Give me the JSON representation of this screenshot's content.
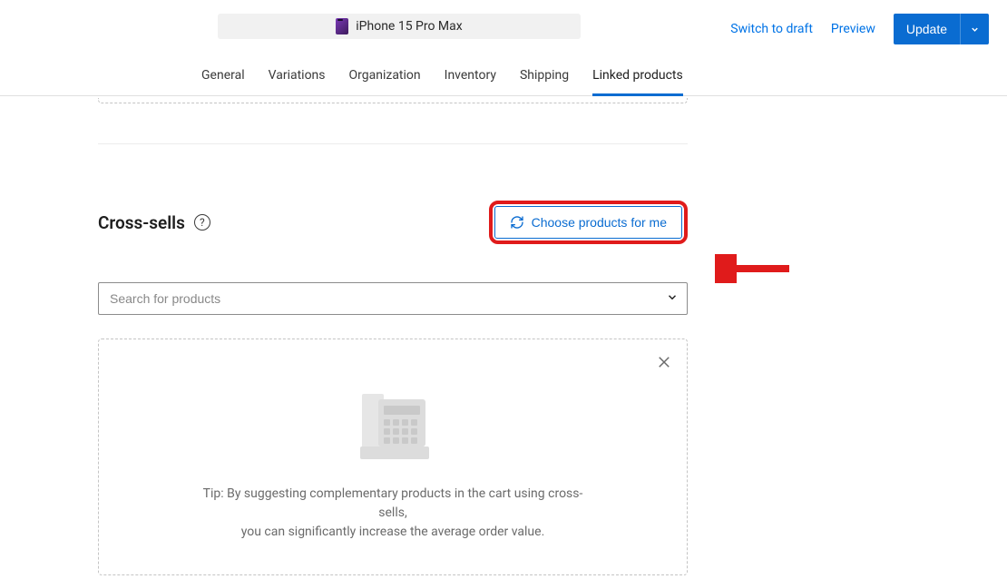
{
  "header": {
    "product_name": "iPhone 15 Pro Max",
    "switch_draft": "Switch to draft",
    "preview": "Preview",
    "update": "Update"
  },
  "tabs": {
    "items": [
      {
        "label": "General"
      },
      {
        "label": "Variations"
      },
      {
        "label": "Organization"
      },
      {
        "label": "Inventory"
      },
      {
        "label": "Shipping"
      },
      {
        "label": "Linked products"
      }
    ],
    "active_index": 5
  },
  "cross_sells": {
    "title": "Cross-sells",
    "choose_label": "Choose products for me",
    "search_placeholder": "Search for products",
    "tip_line1": "Tip: By suggesting complementary products in the cart using cross-sells,",
    "tip_line2": "you can significantly increase the average order value."
  }
}
